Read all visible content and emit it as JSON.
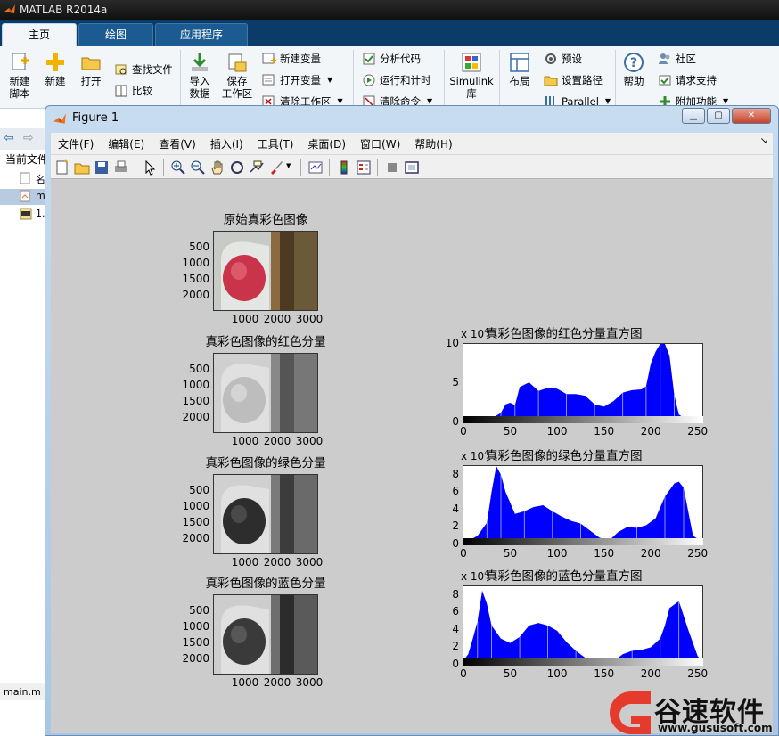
{
  "app": {
    "title": "MATLAB R2014a"
  },
  "tabs": [
    {
      "label": "主页"
    },
    {
      "label": "绘图"
    },
    {
      "label": "应用程序"
    }
  ],
  "ribbon": {
    "new_script": "新建\n脚本",
    "new": "新建",
    "open": "打开",
    "find_files": "查找文件",
    "compare": "比较",
    "import_data": "导入\n数据",
    "save_workspace": "保存\n工作区",
    "new_variable": "新建变量",
    "open_variable": "打开变量",
    "clear_workspace": "清除工作区",
    "analyze_code": "分析代码",
    "run_and_time": "运行和计时",
    "clear_commands": "清除命令",
    "simulink": "Simulink\n库",
    "layout": "布局",
    "preferences": "预设",
    "set_path": "设置路径",
    "parallel": "Parallel",
    "help": "帮助",
    "community": "社区",
    "request_support": "请求支持",
    "addons": "附加功能"
  },
  "sidebar": {
    "current_folder": "当前文件",
    "files": [
      "名",
      "m",
      "1."
    ],
    "main_file": "main.m"
  },
  "figure": {
    "title": "Figure 1",
    "menus": [
      "文件(F)",
      "编辑(E)",
      "查看(V)",
      "插入(I)",
      "工具(T)",
      "桌面(D)",
      "窗口(W)",
      "帮助(H)"
    ]
  },
  "plots": {
    "image_axes": [
      {
        "title": "原始真彩色图像",
        "mode": "color"
      },
      {
        "title": "真彩色图像的红色分量",
        "mode": "red"
      },
      {
        "title": "真彩色图像的绿色分量",
        "mode": "green"
      },
      {
        "title": "真彩色图像的蓝色分量",
        "mode": "blue"
      }
    ],
    "image_yticks": [
      "500",
      "1000",
      "1500",
      "2000"
    ],
    "image_xticks": [
      "1000",
      "2000",
      "3000"
    ],
    "exponent_label": "x 10",
    "exponent_power": "4"
  },
  "chart_data": [
    {
      "type": "bar",
      "title": "真彩色图像的红色分量直方图",
      "xlim": [
        0,
        255
      ],
      "ylim": [
        0,
        10
      ],
      "xticks": [
        "0",
        "50",
        "100",
        "150",
        "200",
        "250"
      ],
      "yticks": [
        "0",
        "5",
        "10"
      ],
      "y_scale_exponent": 4,
      "color": "#0000ff",
      "x": [
        0,
        20,
        30,
        40,
        45,
        50,
        55,
        60,
        70,
        80,
        90,
        100,
        110,
        120,
        130,
        140,
        150,
        160,
        170,
        180,
        190,
        195,
        200,
        205,
        210,
        215,
        220,
        225,
        230,
        240,
        255
      ],
      "values": [
        0,
        0,
        0.5,
        1.2,
        2.3,
        2.5,
        2.2,
        4.5,
        5.1,
        4.0,
        4.4,
        4.3,
        3.6,
        3.6,
        3.4,
        2.3,
        2.0,
        2.7,
        3.8,
        4.1,
        4.2,
        4.6,
        7.5,
        9.0,
        10.0,
        10.0,
        8.5,
        3.5,
        1.0,
        0.2,
        0
      ]
    },
    {
      "type": "bar",
      "title": "真彩色图像的绿色分量直方图",
      "xlim": [
        0,
        255
      ],
      "ylim": [
        0,
        9
      ],
      "xticks": [
        "0",
        "50",
        "100",
        "150",
        "200",
        "250"
      ],
      "yticks": [
        "0",
        "2",
        "4",
        "6",
        "8"
      ],
      "y_scale_exponent": 4,
      "color": "#0000ff",
      "x": [
        0,
        5,
        15,
        25,
        30,
        35,
        40,
        45,
        55,
        65,
        75,
        85,
        95,
        105,
        115,
        125,
        135,
        145,
        155,
        165,
        175,
        185,
        195,
        205,
        215,
        225,
        230,
        235,
        245,
        255
      ],
      "values": [
        0,
        0.4,
        1.0,
        2.5,
        6.0,
        9.0,
        8.0,
        6.0,
        3.5,
        3.8,
        4.3,
        4.5,
        3.8,
        3.2,
        2.7,
        2.4,
        1.6,
        0.8,
        0.4,
        1.4,
        2.0,
        1.9,
        2.2,
        3.0,
        5.5,
        7.0,
        7.2,
        6.5,
        1.0,
        0.3
      ]
    },
    {
      "type": "bar",
      "title": "真彩色图像的蓝色分量直方图",
      "xlim": [
        0,
        255
      ],
      "ylim": [
        0,
        9
      ],
      "xticks": [
        "0",
        "50",
        "100",
        "150",
        "200",
        "250"
      ],
      "yticks": [
        "0",
        "2",
        "4",
        "6",
        "8"
      ],
      "y_scale_exponent": 4,
      "color": "#0000ff",
      "x": [
        0,
        5,
        10,
        15,
        20,
        25,
        30,
        40,
        50,
        60,
        70,
        80,
        90,
        100,
        110,
        120,
        130,
        140,
        150,
        160,
        170,
        180,
        190,
        200,
        210,
        215,
        220,
        230,
        240,
        250,
        255
      ],
      "values": [
        0.5,
        1.2,
        3.0,
        5.0,
        8.5,
        7.0,
        4.5,
        3.0,
        2.5,
        3.2,
        4.5,
        4.8,
        4.5,
        3.9,
        2.6,
        1.6,
        0.8,
        0.3,
        0.2,
        0.4,
        1.2,
        1.6,
        1.7,
        2.0,
        3.0,
        4.5,
        6.5,
        7.3,
        4.0,
        1.0,
        0.3
      ]
    }
  ],
  "watermark": {
    "brand": "谷速软件",
    "url": "www.gususoft.com"
  }
}
